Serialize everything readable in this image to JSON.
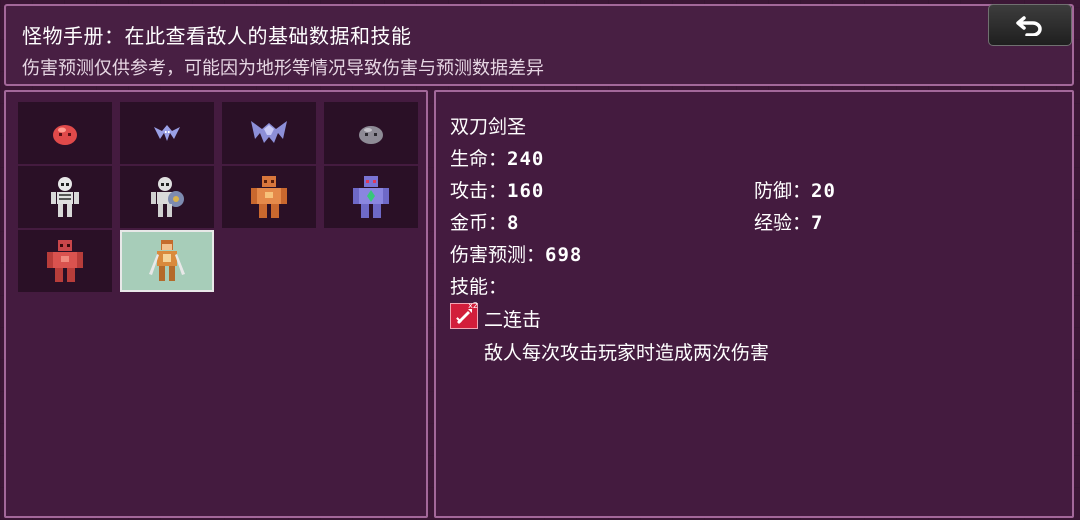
{
  "header": {
    "title": "怪物手册：在此查看敌人的基础数据和技能",
    "subtitle": "伤害预测仅供参考，可能因为地形等情况导致伤害与预测数据差异",
    "back_icon": "return-arrow-icon"
  },
  "monster_grid": {
    "selected_index": 9,
    "monsters": [
      {
        "icon": "red-slime-icon",
        "color": "#e04a4a"
      },
      {
        "icon": "small-bat-icon",
        "color": "#9aa0e6"
      },
      {
        "icon": "big-bat-icon",
        "color": "#8d8fd8"
      },
      {
        "icon": "gray-slime-icon",
        "color": "#8e8b96"
      },
      {
        "icon": "skeleton-icon",
        "color": "#e8e8e8"
      },
      {
        "icon": "skeleton-soldier-icon",
        "color": "#e0e0e0"
      },
      {
        "icon": "orange-golem-icon",
        "color": "#e58a4a"
      },
      {
        "icon": "purple-golem-icon",
        "color": "#8a86e0"
      },
      {
        "icon": "red-golem-icon",
        "color": "#d9534f"
      },
      {
        "icon": "dual-blade-swordsman-icon",
        "color": "#d98a3c"
      }
    ]
  },
  "detail": {
    "name": "双刀剑圣",
    "hp_label": "生命：",
    "hp_value": "240",
    "atk_label": "攻击：",
    "atk_value": "160",
    "def_label": "防御：",
    "def_value": "20",
    "gold_label": "金币：",
    "gold_value": "8",
    "exp_label": "经验：",
    "exp_value": "7",
    "damage_label": "伤害预测：",
    "damage_value": "698",
    "skills_label": "技能：",
    "skill": {
      "icon": "double-strike-sword-icon",
      "badge": "x2",
      "name": "二连击",
      "description": "敌人每次攻击玩家时造成两次伤害",
      "color": "#d21e3b"
    }
  }
}
